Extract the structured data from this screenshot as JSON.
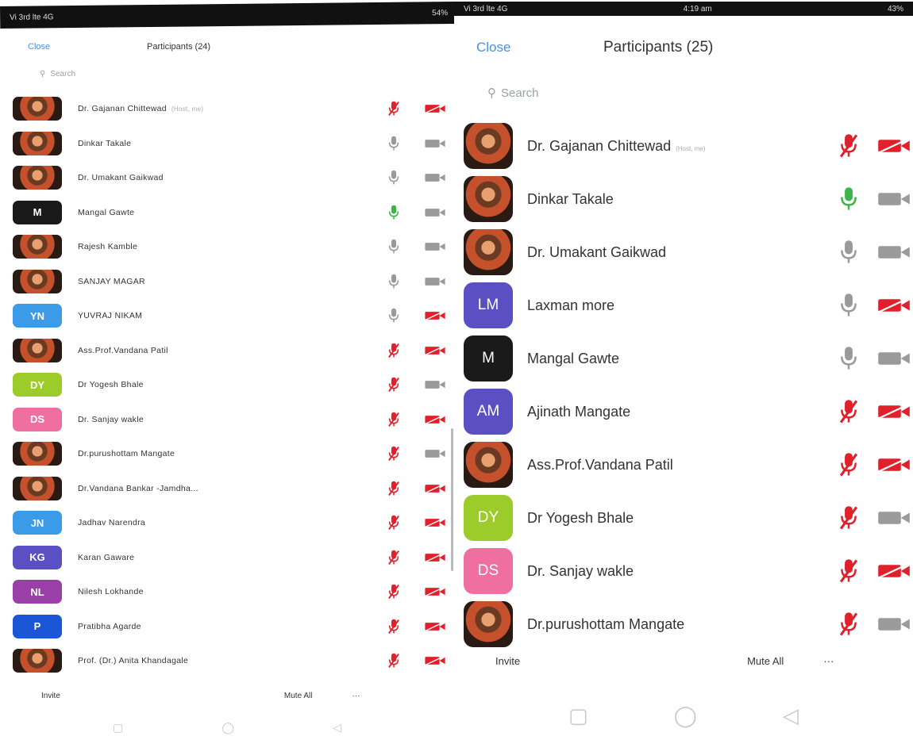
{
  "left": {
    "status_left": "Vi 3rd lte 4G",
    "status_right": "54%",
    "close": "Close",
    "title": "Participants (24)",
    "search_placeholder": "Search",
    "participants": [
      {
        "name": "Dr. Gajanan Chittewad",
        "host": "(Host, me)",
        "avatar": "photo",
        "color": "",
        "mic": "muted",
        "cam": "off"
      },
      {
        "name": "Dinkar Takale",
        "host": "",
        "avatar": "photo",
        "color": "",
        "mic": "idle",
        "cam": "on"
      },
      {
        "name": "Dr. Umakant Gaikwad",
        "host": "",
        "avatar": "photo",
        "color": "",
        "mic": "idle",
        "cam": "on"
      },
      {
        "name": "Mangal Gawte",
        "host": "",
        "avatar": "M",
        "color": "#1a1a1a",
        "mic": "active",
        "cam": "on"
      },
      {
        "name": "Rajesh Kamble",
        "host": "",
        "avatar": "photo",
        "color": "",
        "mic": "idle",
        "cam": "on"
      },
      {
        "name": "SANJAY MAGAR",
        "host": "",
        "avatar": "photo",
        "color": "",
        "mic": "idle",
        "cam": "on"
      },
      {
        "name": "YUVRAJ NIKAM",
        "host": "",
        "avatar": "YN",
        "color": "#3b9be8",
        "mic": "idle",
        "cam": "off"
      },
      {
        "name": "Ass.Prof.Vandana Patil",
        "host": "",
        "avatar": "photo",
        "color": "",
        "mic": "muted",
        "cam": "off"
      },
      {
        "name": "Dr Yogesh Bhale",
        "host": "",
        "avatar": "DY",
        "color": "#9ccc2a",
        "mic": "muted",
        "cam": "on"
      },
      {
        "name": "Dr. Sanjay wakle",
        "host": "",
        "avatar": "DS",
        "color": "#ef6fa0",
        "mic": "muted",
        "cam": "off"
      },
      {
        "name": "Dr.purushottam Mangate",
        "host": "",
        "avatar": "photo",
        "color": "",
        "mic": "muted",
        "cam": "on"
      },
      {
        "name": "Dr.Vandana Bankar -Jamdha...",
        "host": "",
        "avatar": "photo",
        "color": "",
        "mic": "muted",
        "cam": "off"
      },
      {
        "name": "Jadhav Narendra",
        "host": "",
        "avatar": "JN",
        "color": "#3b9be8",
        "mic": "muted",
        "cam": "off"
      },
      {
        "name": "Karan Gaware",
        "host": "",
        "avatar": "KG",
        "color": "#5b4fc4",
        "mic": "muted",
        "cam": "off"
      },
      {
        "name": "Nilesh Lokhande",
        "host": "",
        "avatar": "NL",
        "color": "#9b3fa8",
        "mic": "muted",
        "cam": "off"
      },
      {
        "name": "Pratibha Agarde",
        "host": "",
        "avatar": "P",
        "color": "#1a56d6",
        "mic": "muted",
        "cam": "off"
      },
      {
        "name": "Prof. (Dr.) Anita Khandagale",
        "host": "",
        "avatar": "photo",
        "color": "",
        "mic": "muted",
        "cam": "off"
      }
    ],
    "invite": "Invite",
    "mute_all": "Mute All",
    "more": "···"
  },
  "right": {
    "status_left": "Vi 3rd lte 4G",
    "status_center": "4:19 am",
    "status_right": "43%",
    "close": "Close",
    "title": "Participants (25)",
    "search_placeholder": "Search",
    "participants": [
      {
        "name": "Dr. Gajanan Chittewad",
        "host": "(Host, me)",
        "avatar": "photo",
        "color": "",
        "mic": "muted",
        "cam": "off"
      },
      {
        "name": "Dinkar Takale",
        "host": "",
        "avatar": "photo",
        "color": "",
        "mic": "active",
        "cam": "on"
      },
      {
        "name": "Dr. Umakant Gaikwad",
        "host": "",
        "avatar": "photo",
        "color": "",
        "mic": "idle",
        "cam": "on"
      },
      {
        "name": "Laxman more",
        "host": "",
        "avatar": "LM",
        "color": "#5b4fc4",
        "mic": "idle",
        "cam": "off"
      },
      {
        "name": "Mangal Gawte",
        "host": "",
        "avatar": "M",
        "color": "#1a1a1a",
        "mic": "idle",
        "cam": "on"
      },
      {
        "name": "Ajinath Mangate",
        "host": "",
        "avatar": "AM",
        "color": "#5b4fc4",
        "mic": "muted",
        "cam": "off"
      },
      {
        "name": "Ass.Prof.Vandana Patil",
        "host": "",
        "avatar": "photo",
        "color": "",
        "mic": "muted",
        "cam": "off"
      },
      {
        "name": "Dr Yogesh Bhale",
        "host": "",
        "avatar": "DY",
        "color": "#9ccc2a",
        "mic": "muted",
        "cam": "on"
      },
      {
        "name": "Dr. Sanjay wakle",
        "host": "",
        "avatar": "DS",
        "color": "#ef6fa0",
        "mic": "muted",
        "cam": "off"
      },
      {
        "name": "Dr.purushottam Mangate",
        "host": "",
        "avatar": "photo",
        "color": "",
        "mic": "muted",
        "cam": "on"
      }
    ],
    "invite": "Invite",
    "mute_all": "Mute All",
    "more": "···"
  },
  "colors": {
    "accent": "#4a90e2",
    "muted_red": "#e0202a",
    "active_green": "#3bb54a",
    "idle_gray": "#9a9a9a"
  },
  "icons": {
    "mic": "microphone-icon",
    "cam": "video-camera-icon",
    "search": "search-icon",
    "nav_back": "back-triangle-icon",
    "nav_home": "home-circle-icon",
    "nav_recent": "recent-square-icon"
  }
}
